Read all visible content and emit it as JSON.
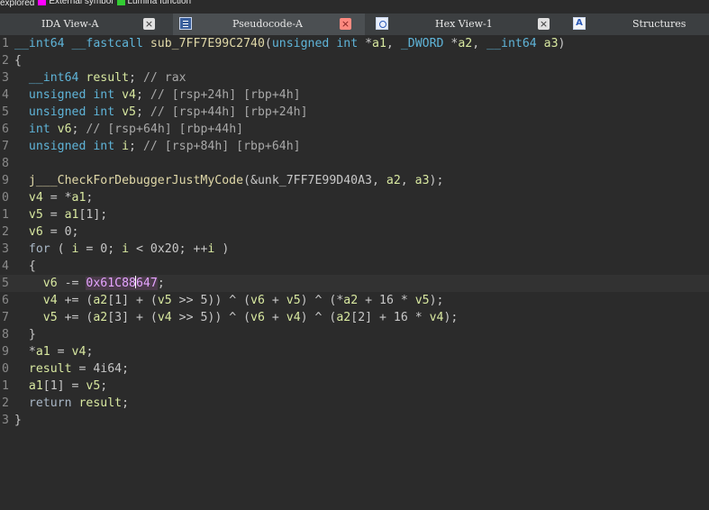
{
  "legend": [
    {
      "label": "explored",
      "color": ""
    },
    {
      "label": "External symbol",
      "color": "#ff00ff"
    },
    {
      "label": "Lumina function",
      "color": "#33cc33"
    }
  ],
  "tabs": [
    {
      "label": "IDA View-A",
      "icon": "",
      "active": false,
      "close": "×"
    },
    {
      "label": "Pseudocode-A",
      "icon": "pseudocode-icon",
      "active": true,
      "close": "×"
    },
    {
      "label": "Hex View-1",
      "icon": "hex-view-icon",
      "active": false,
      "close": "×"
    },
    {
      "label": "Structures",
      "icon": "structures-icon",
      "active": false
    }
  ],
  "code_lines": [
    {
      "ln": "1",
      "tokens": [
        [
          "type",
          "__int64 __fastcall "
        ],
        [
          "fn",
          "sub_7FF7E99C2740"
        ],
        [
          "txt",
          "("
        ],
        [
          "type",
          "unsigned int "
        ],
        [
          "txt",
          "*"
        ],
        [
          "var",
          "a1"
        ],
        [
          "txt",
          ", "
        ],
        [
          "type",
          "_DWORD "
        ],
        [
          "txt",
          "*"
        ],
        [
          "var",
          "a2"
        ],
        [
          "txt",
          ", "
        ],
        [
          "type",
          "__int64 "
        ],
        [
          "var",
          "a3"
        ],
        [
          "txt",
          ")"
        ]
      ]
    },
    {
      "ln": "2",
      "tokens": [
        [
          "txt",
          "{"
        ]
      ]
    },
    {
      "ln": "3",
      "tokens": [
        [
          "type",
          "  __int64 "
        ],
        [
          "var",
          "result"
        ],
        [
          "txt",
          "; "
        ],
        [
          "cm",
          "// rax"
        ]
      ]
    },
    {
      "ln": "4",
      "tokens": [
        [
          "type",
          "  unsigned int "
        ],
        [
          "var",
          "v4"
        ],
        [
          "txt",
          "; "
        ],
        [
          "cm",
          "// [rsp+24h] [rbp+4h]"
        ]
      ]
    },
    {
      "ln": "5",
      "tokens": [
        [
          "type",
          "  unsigned int "
        ],
        [
          "var",
          "v5"
        ],
        [
          "txt",
          "; "
        ],
        [
          "cm",
          "// [rsp+44h] [rbp+24h]"
        ]
      ]
    },
    {
      "ln": "6",
      "tokens": [
        [
          "type",
          "  int "
        ],
        [
          "var",
          "v6"
        ],
        [
          "txt",
          "; "
        ],
        [
          "cm",
          "// [rsp+64h] [rbp+44h]"
        ]
      ]
    },
    {
      "ln": "7",
      "tokens": [
        [
          "type",
          "  unsigned int "
        ],
        [
          "var",
          "i"
        ],
        [
          "txt",
          "; "
        ],
        [
          "cm",
          "// [rsp+84h] [rbp+64h]"
        ]
      ]
    },
    {
      "ln": "8",
      "tokens": []
    },
    {
      "ln": "9",
      "tokens": [
        [
          "fn",
          "  j___CheckForDebuggerJustMyCode"
        ],
        [
          "txt",
          "(&unk_7FF7E99D40A3, "
        ],
        [
          "var",
          "a2"
        ],
        [
          "txt",
          ", "
        ],
        [
          "var",
          "a3"
        ],
        [
          "txt",
          ");"
        ]
      ]
    },
    {
      "ln": "0",
      "tokens": [
        [
          "var",
          "  v4"
        ],
        [
          "txt",
          " = *"
        ],
        [
          "var",
          "a1"
        ],
        [
          "txt",
          ";"
        ]
      ]
    },
    {
      "ln": "1",
      "tokens": [
        [
          "var",
          "  v5"
        ],
        [
          "txt",
          " = "
        ],
        [
          "var",
          "a1"
        ],
        [
          "txt",
          "[1];"
        ]
      ]
    },
    {
      "ln": "2",
      "tokens": [
        [
          "var",
          "  v6"
        ],
        [
          "txt",
          " = 0;"
        ]
      ]
    },
    {
      "ln": "3",
      "tokens": [
        [
          "kw",
          "  for"
        ],
        [
          "txt",
          " ( "
        ],
        [
          "var",
          "i"
        ],
        [
          "txt",
          " = 0; "
        ],
        [
          "var",
          "i"
        ],
        [
          "txt",
          " < 0x20; ++"
        ],
        [
          "var",
          "i"
        ],
        [
          "txt",
          " )"
        ]
      ]
    },
    {
      "ln": "4",
      "tokens": [
        [
          "txt",
          "  {"
        ]
      ]
    },
    {
      "ln": "5",
      "hl": true,
      "tokens": [
        [
          "var",
          "    v6"
        ],
        [
          "txt",
          " -= "
        ],
        [
          "hex",
          "0x61C88"
        ],
        [
          "caret",
          ""
        ],
        [
          "hex",
          "647"
        ],
        [
          "txt",
          ";"
        ]
      ]
    },
    {
      "ln": "6",
      "tokens": [
        [
          "var",
          "    v4"
        ],
        [
          "txt",
          " += ("
        ],
        [
          "var",
          "a2"
        ],
        [
          "txt",
          "[1] + ("
        ],
        [
          "var",
          "v5"
        ],
        [
          "txt",
          " >> 5)) ^ ("
        ],
        [
          "var",
          "v6"
        ],
        [
          "txt",
          " + "
        ],
        [
          "var",
          "v5"
        ],
        [
          "txt",
          ") ^ (*"
        ],
        [
          "var",
          "a2"
        ],
        [
          "txt",
          " + 16 * "
        ],
        [
          "var",
          "v5"
        ],
        [
          "txt",
          ");"
        ]
      ]
    },
    {
      "ln": "7",
      "tokens": [
        [
          "var",
          "    v5"
        ],
        [
          "txt",
          " += ("
        ],
        [
          "var",
          "a2"
        ],
        [
          "txt",
          "[3] + ("
        ],
        [
          "var",
          "v4"
        ],
        [
          "txt",
          " >> 5)) ^ ("
        ],
        [
          "var",
          "v6"
        ],
        [
          "txt",
          " + "
        ],
        [
          "var",
          "v4"
        ],
        [
          "txt",
          ") ^ ("
        ],
        [
          "var",
          "a2"
        ],
        [
          "txt",
          "[2] + 16 * "
        ],
        [
          "var",
          "v4"
        ],
        [
          "txt",
          ");"
        ]
      ]
    },
    {
      "ln": "8",
      "tokens": [
        [
          "txt",
          "  }"
        ]
      ]
    },
    {
      "ln": "9",
      "tokens": [
        [
          "txt",
          "  *"
        ],
        [
          "var",
          "a1"
        ],
        [
          "txt",
          " = "
        ],
        [
          "var",
          "v4"
        ],
        [
          "txt",
          ";"
        ]
      ]
    },
    {
      "ln": "0",
      "tokens": [
        [
          "var",
          "  result"
        ],
        [
          "txt",
          " = 4i64;"
        ]
      ]
    },
    {
      "ln": "1",
      "tokens": [
        [
          "var",
          "  a1"
        ],
        [
          "txt",
          "[1] = "
        ],
        [
          "var",
          "v5"
        ],
        [
          "txt",
          ";"
        ]
      ]
    },
    {
      "ln": "2",
      "tokens": [
        [
          "kw",
          "  return "
        ],
        [
          "var",
          "result"
        ],
        [
          "txt",
          ";"
        ]
      ]
    },
    {
      "ln": "3",
      "tokens": [
        [
          "txt",
          "}"
        ]
      ]
    }
  ],
  "colors": {
    "background": "#2b2b2b",
    "type": "#5fb4d8",
    "variable": "#d8e8a0",
    "comment": "#a8a8a8",
    "hex_constant": "#e5a4ff",
    "active_tab_close": "#ff8a80"
  }
}
